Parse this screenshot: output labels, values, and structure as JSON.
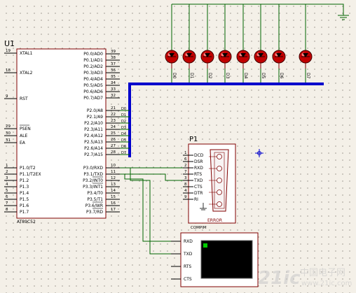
{
  "mcu": {
    "ref": "U1",
    "part": "AT89C52",
    "pins_left": [
      {
        "num": "19",
        "name": "XTAL1"
      },
      {
        "num": "18",
        "name": "XTAL2"
      },
      {
        "num": "9",
        "name": "RST"
      },
      {
        "num": "29",
        "name": "PSEN"
      },
      {
        "num": "30",
        "name": "ALE"
      },
      {
        "num": "31",
        "name": "EA"
      },
      {
        "num": "1",
        "name": "P1.0/T2"
      },
      {
        "num": "2",
        "name": "P1.1/T2EX"
      },
      {
        "num": "3",
        "name": "P1.2"
      },
      {
        "num": "4",
        "name": "P1.3"
      },
      {
        "num": "5",
        "name": "P1.4"
      },
      {
        "num": "6",
        "name": "P1.5"
      },
      {
        "num": "7",
        "name": "P1.6"
      },
      {
        "num": "8",
        "name": "P1.7"
      }
    ],
    "pins_right": [
      {
        "num": "39",
        "name": "P0.0/AD0",
        "net": ""
      },
      {
        "num": "38",
        "name": "P0.1/AD1",
        "net": ""
      },
      {
        "num": "37",
        "name": "P0.2/AD2",
        "net": ""
      },
      {
        "num": "36",
        "name": "P0.3/AD3",
        "net": ""
      },
      {
        "num": "35",
        "name": "P0.4/AD4",
        "net": ""
      },
      {
        "num": "34",
        "name": "P0.5/AD5",
        "net": ""
      },
      {
        "num": "33",
        "name": "P0.6/AD6",
        "net": ""
      },
      {
        "num": "32",
        "name": "P0.7/AD7",
        "net": ""
      },
      {
        "num": "21",
        "name": "P2.0/A8",
        "net": "D0"
      },
      {
        "num": "22",
        "name": "P2.1/A9",
        "net": "D1"
      },
      {
        "num": "23",
        "name": "P2.2/A10",
        "net": "D2"
      },
      {
        "num": "24",
        "name": "P2.3/A11",
        "net": "D3"
      },
      {
        "num": "25",
        "name": "P2.4/A12",
        "net": "D4"
      },
      {
        "num": "26",
        "name": "P2.5/A13",
        "net": "D5"
      },
      {
        "num": "27",
        "name": "P2.6/A14",
        "net": "D6"
      },
      {
        "num": "28",
        "name": "P2.7/A15",
        "net": "D7"
      },
      {
        "num": "10",
        "name": "P3.0/RXD",
        "net": ""
      },
      {
        "num": "11",
        "name": "P3.1/TXD",
        "net": ""
      },
      {
        "num": "12",
        "name": "P3.2/INT0",
        "net": ""
      },
      {
        "num": "13",
        "name": "P3.3/INT1",
        "net": ""
      },
      {
        "num": "14",
        "name": "P3.4/T0",
        "net": ""
      },
      {
        "num": "15",
        "name": "P3.5/T1",
        "net": ""
      },
      {
        "num": "16",
        "name": "P3.6/WR",
        "net": ""
      },
      {
        "num": "17",
        "name": "P3.7/RD",
        "net": ""
      }
    ]
  },
  "leds": {
    "labels": [
      "D0",
      "D1",
      "D2",
      "D3",
      "D4",
      "D5",
      "D6",
      "D7"
    ],
    "color": "#c00000"
  },
  "compim": {
    "ref": "P1",
    "part": "COMPIM",
    "status": "ERROR",
    "pins": [
      {
        "num": "1",
        "name": "DCD"
      },
      {
        "num": "6",
        "name": "DSR"
      },
      {
        "num": "2",
        "name": "RXD"
      },
      {
        "num": "7",
        "name": "RTS"
      },
      {
        "num": "3",
        "name": "TXD"
      },
      {
        "num": "8",
        "name": "CTS"
      },
      {
        "num": "4",
        "name": "DTR"
      },
      {
        "num": "9",
        "name": "RI"
      }
    ]
  },
  "terminal": {
    "pins": [
      "RXD",
      "TXD",
      "RTS",
      "CTS"
    ],
    "cursor_color": "#00cc00"
  },
  "colors": {
    "wire": "#006400",
    "bus": "#0000cc",
    "body_fill": "#ffffff",
    "outline": "#800000",
    "marker": "#0000cc"
  },
  "watermark": {
    "logo": "21ic",
    "cn": "中国电子网",
    "url": "www.21ic.com"
  }
}
